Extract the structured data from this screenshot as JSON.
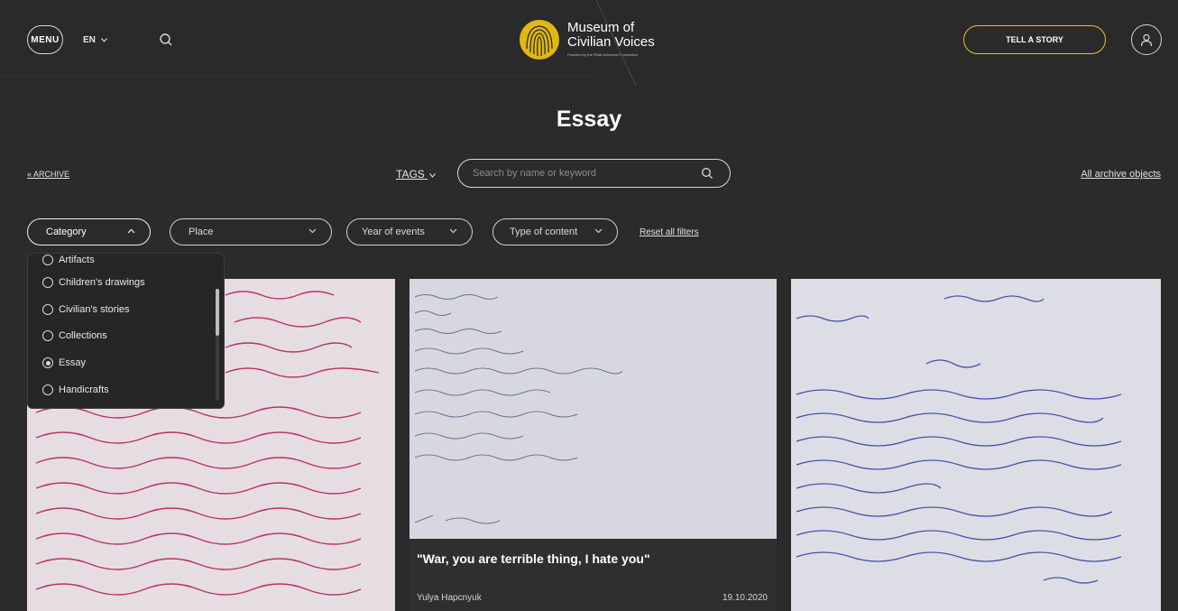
{
  "header": {
    "menu_label": "MENU",
    "language": "EN",
    "logo_title": "Museum of\nCivilian Voices",
    "logo_subtitle": "Founded by the Rinat Akhmetov Foundation",
    "cta_label": "TELL A STORY",
    "icons": {
      "search": "search-icon",
      "user": "user-icon",
      "chevron": "chevron-down-icon"
    }
  },
  "page": {
    "title": "Essay"
  },
  "toolbar": {
    "archive_link": "« ARCHIVE",
    "tags_label": "TAGS",
    "search_placeholder": "Search by name or keyword",
    "all_objects_link": "All archive objects"
  },
  "filters": {
    "items": [
      {
        "label": "Category"
      },
      {
        "label": "Place"
      },
      {
        "label": "Year of events"
      },
      {
        "label": "Type of content"
      }
    ],
    "reset_label": "Reset all filters"
  },
  "category_dropdown": {
    "options": [
      {
        "label": "Artifacts",
        "selected": false
      },
      {
        "label": "Children's drawings",
        "selected": false
      },
      {
        "label": "Civilian's stories",
        "selected": false
      },
      {
        "label": "Collections",
        "selected": false
      },
      {
        "label": "Essay",
        "selected": true
      },
      {
        "label": "Handicrafts",
        "selected": false
      }
    ]
  },
  "cards": [
    {
      "title": "",
      "author": "",
      "date": ""
    },
    {
      "title": "\"War, you are terrible thing, I hate you\"",
      "author": "Yulya Hapcnyuk",
      "date": "19.10.2020"
    },
    {
      "title": "",
      "author": "",
      "date": ""
    }
  ],
  "colors": {
    "background": "#2b2b2b",
    "accent": "#e6c31c",
    "text": "#ffffff"
  }
}
